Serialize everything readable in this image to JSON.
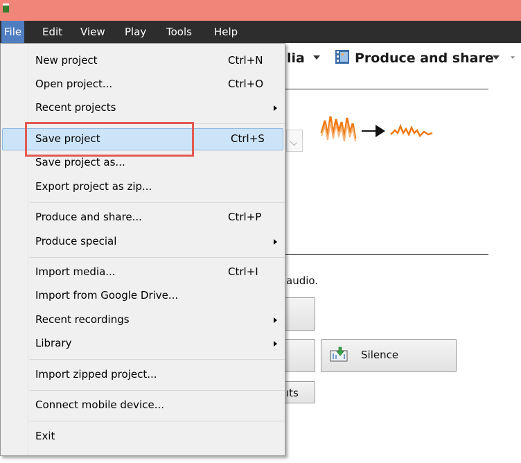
{
  "menubar": {
    "items": [
      "File",
      "Edit",
      "View",
      "Play",
      "Tools",
      "Help"
    ]
  },
  "toolbar": {
    "media_partial": "lia",
    "produce_label": "Produce and share"
  },
  "file_menu": {
    "items": [
      {
        "label": "New project",
        "shortcut": "Ctrl+N",
        "submenu": false
      },
      {
        "label": "Open project...",
        "shortcut": "Ctrl+O",
        "submenu": false
      },
      {
        "label": "Recent projects",
        "shortcut": "",
        "submenu": true
      },
      {
        "label": "Save project",
        "shortcut": "Ctrl+S",
        "submenu": false,
        "highlighted": true
      },
      {
        "label": "Save project as...",
        "shortcut": "",
        "submenu": false
      },
      {
        "label": "Export project as zip...",
        "shortcut": "",
        "submenu": false
      },
      {
        "label": "Produce and share...",
        "shortcut": "Ctrl+P",
        "submenu": false
      },
      {
        "label": "Produce special",
        "shortcut": "",
        "submenu": true
      },
      {
        "label": "Import media...",
        "shortcut": "Ctrl+I",
        "submenu": false
      },
      {
        "label": "Import from Google Drive...",
        "shortcut": "",
        "submenu": false
      },
      {
        "label": "Recent recordings",
        "shortcut": "",
        "submenu": true
      },
      {
        "label": "Library",
        "shortcut": "",
        "submenu": true
      },
      {
        "label": "Import zipped project...",
        "shortcut": "",
        "submenu": false
      },
      {
        "label": "Connect mobile device...",
        "shortcut": "",
        "submenu": false
      },
      {
        "label": "Exit",
        "shortcut": "",
        "submenu": false
      }
    ]
  },
  "background": {
    "audio_text_partial": "audio.",
    "silence_label": "Silence",
    "ts_partial": "ıts"
  },
  "colors": {
    "titlebar": "#f2857a",
    "menubar": "#2d2d2d",
    "menu_active": "#4f7ec0",
    "highlight": "#cce4f7",
    "annotation": "#e25a52",
    "waveform": "#f07a10"
  },
  "icons": {
    "app": "app-icon",
    "produce": "film-icon",
    "silence": "silence-icon",
    "waveform": "waveform-compress-icon"
  }
}
